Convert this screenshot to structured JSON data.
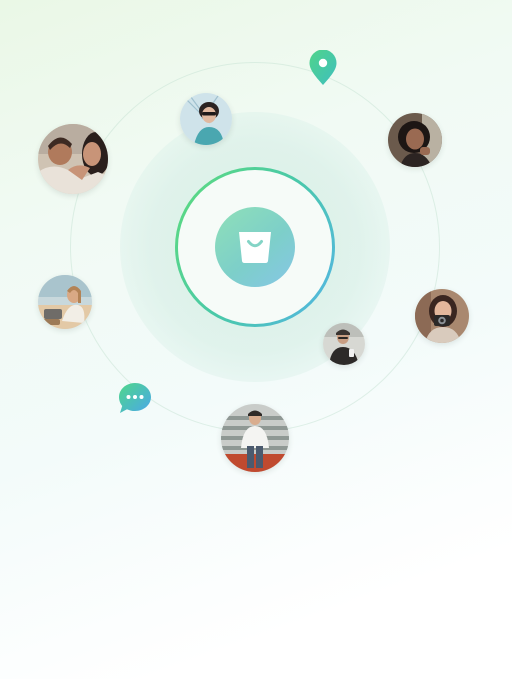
{
  "scene": {
    "center_icon": "shopping-bag-icon",
    "floating_icons": [
      "location-pin-icon",
      "chat-bubble-icon"
    ],
    "accent_colors": {
      "green": "#5fdc7c",
      "teal": "#49c9a8",
      "blue": "#55b4e8"
    },
    "avatars": [
      "avatar-couple",
      "avatar-woman-sunglasses",
      "avatar-woman-curly-hair",
      "avatar-woman-tablet",
      "avatar-woman-camera",
      "avatar-man-phone",
      "avatar-man-white-shirt"
    ]
  }
}
